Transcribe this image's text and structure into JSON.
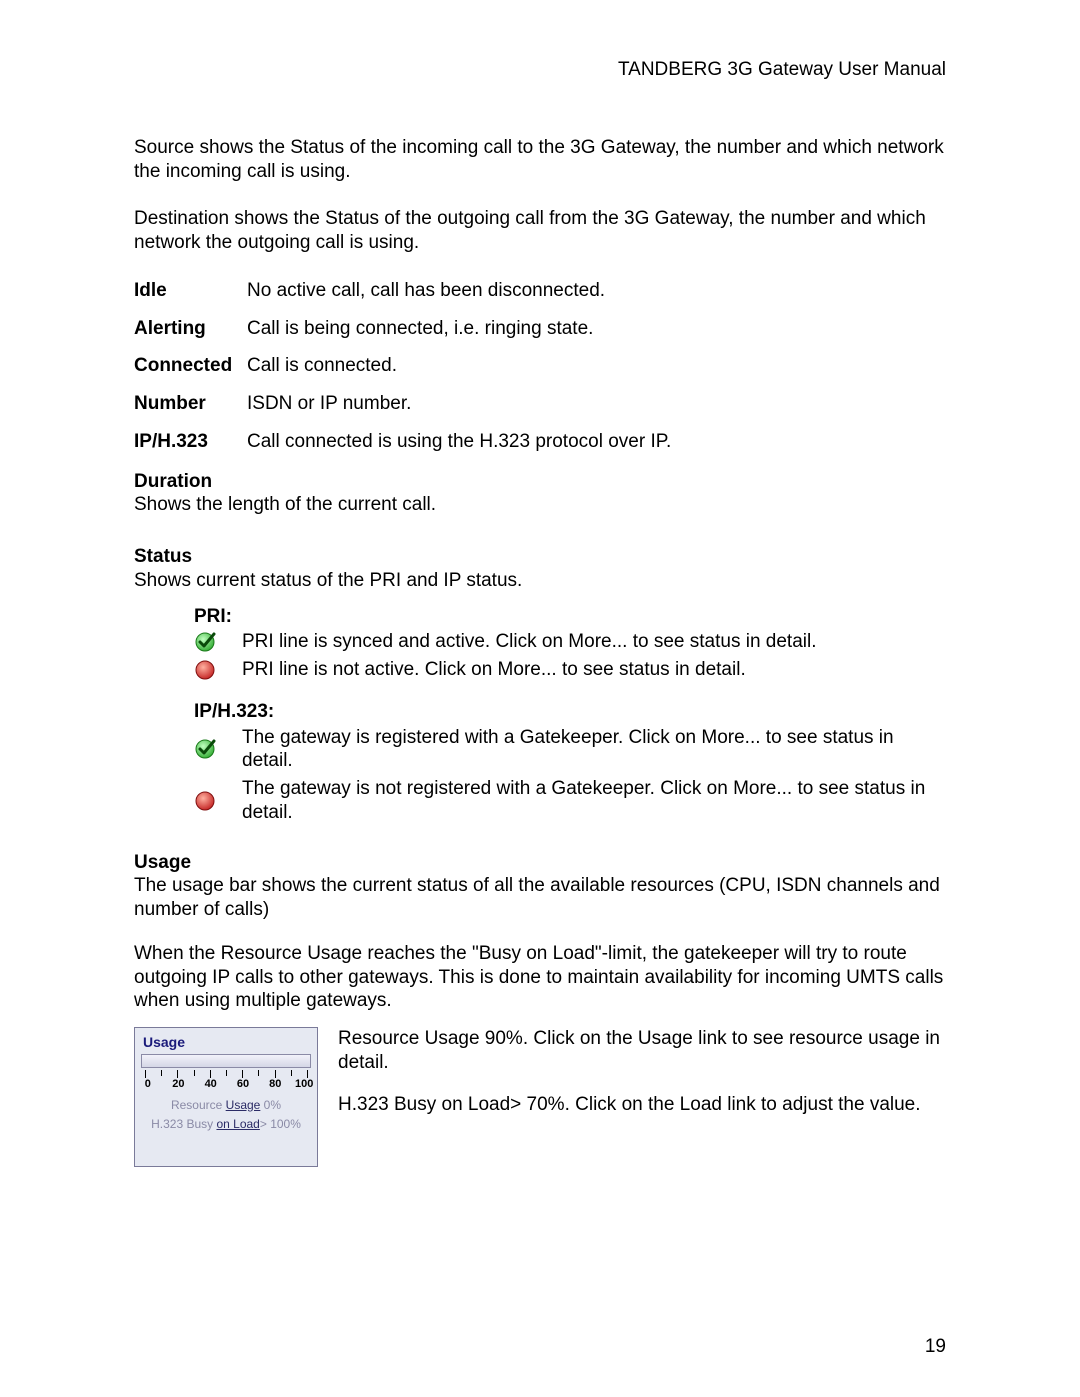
{
  "header": {
    "title": "TANDBERG 3G Gateway User Manual"
  },
  "intro": {
    "p1": "Source shows the Status of the incoming call to the 3G Gateway, the number and which network the incoming call is using.",
    "p2": "Destination shows the Status of the outgoing call from the 3G Gateway, the number and which network the outgoing call is using."
  },
  "defs": [
    {
      "term": "Idle",
      "desc": "No active call, call has been disconnected."
    },
    {
      "term": "Alerting",
      "desc": "Call is being connected, i.e. ringing state."
    },
    {
      "term": "Connected",
      "desc": "Call is connected."
    },
    {
      "term": "Number",
      "desc": "ISDN or IP number."
    },
    {
      "term": "IP/H.323",
      "desc": "Call connected is using the H.323 protocol over IP."
    }
  ],
  "duration": {
    "title": "Duration",
    "desc": "Shows the length of the current call."
  },
  "status": {
    "title": "Status",
    "desc": "Shows current status of the PRI and IP status.",
    "pri": {
      "title": "PRI:",
      "ok": "PRI line is synced and active. Click on More... to see status in detail.",
      "bad": "PRI line is not active. Click on More... to see status in detail."
    },
    "ip": {
      "title": "IP/H.323:",
      "ok": "The gateway is registered with a Gatekeeper. Click on More... to see status in detail.",
      "bad": "The gateway is not registered with a Gatekeeper. Click on More... to see status in detail."
    }
  },
  "usage": {
    "title": "Usage",
    "p1": "The usage bar shows the current status of all the available resources (CPU, ISDN channels and number of calls)",
    "p2": "When the Resource Usage reaches the \"Busy on Load\"-limit, the gatekeeper will try to route outgoing IP calls to other gateways. This is done to maintain availability for incoming UMTS calls when using multiple gateways.",
    "widget": {
      "title": "Usage",
      "scale": [
        "0",
        "20",
        "40",
        "60",
        "80",
        "100"
      ],
      "line1_prefix": "Resource ",
      "line1_link": "Usage",
      "line1_suffix": " 0%",
      "line2_prefix": "H.323 Busy ",
      "line2_link": "on Load",
      "line2_suffix": "> 100%"
    },
    "right": {
      "p1": "Resource Usage 90%. Click on the Usage link to see resource usage in detail.",
      "p2": "H.323 Busy on Load> 70%. Click on the Load link to adjust the value."
    }
  },
  "page_number": "19"
}
